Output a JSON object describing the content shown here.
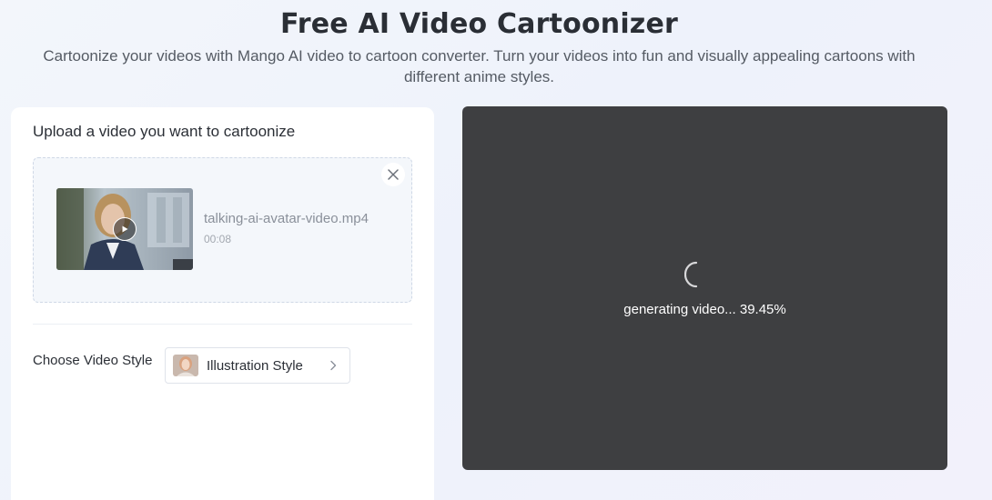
{
  "header": {
    "title": "Free AI Video Cartoonizer",
    "subtitle": "Cartoonize your videos with Mango AI video to cartoon converter. Turn your videos into fun and visually appealing cartoons with different anime styles."
  },
  "upload": {
    "title": "Upload a video you want to cartoonize",
    "file_name": "talking-ai-avatar-video.mp4",
    "duration": "00:08",
    "close_icon": "close-icon",
    "play_icon": "play-icon"
  },
  "style": {
    "label": "Choose Video Style",
    "selected": "Illustration Style",
    "chevron_icon": "chevron-right-icon"
  },
  "preview": {
    "status": "generating video... 39.45%",
    "progress_percent": 39.45,
    "spinner_icon": "loading-spinner-icon"
  },
  "colors": {
    "preview_background": "#3e3f41",
    "panel_background": "#ffffff",
    "page_background": "#f3f6fb"
  }
}
